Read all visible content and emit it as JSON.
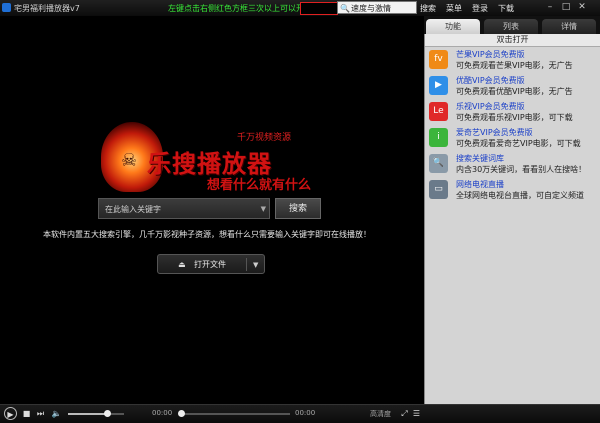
{
  "titlebar": {
    "title": "宅男福利播放器v7",
    "notice": "左键点击右侧红色方框三次以上可以开启隐藏功能",
    "search_value": "速度与激情",
    "menu": [
      "搜索",
      "菜单",
      "登录",
      "下载"
    ]
  },
  "tabs": [
    "功能",
    "列表",
    "详情"
  ],
  "panel": {
    "header": "双击打开",
    "items": [
      {
        "icon": "mango-tv-icon",
        "color": "#f08a16",
        "glyph": "fv",
        "title": "芒果VIP会员免费版",
        "desc": "可免费观看芒果VIP电影，无广告"
      },
      {
        "icon": "youku-icon",
        "color": "#2f8fe8",
        "glyph": "▶",
        "title": "优酷VIP会员免费版",
        "desc": "可免费观看优酷VIP电影，无广告"
      },
      {
        "icon": "letv-icon",
        "color": "#e02828",
        "glyph": "Le",
        "title": "乐视VIP会员免费版",
        "desc": "可免费观看乐视VIP电影，可下载"
      },
      {
        "icon": "iqiyi-icon",
        "color": "#3bb53b",
        "glyph": "i",
        "title": "爱奇艺VIP会员免费版",
        "desc": "可免费观看爱奇艺VIP电影，可下载"
      },
      {
        "icon": "search-keyword-icon",
        "color": "#8a9aa8",
        "glyph": "🔍",
        "title": "搜索关键词库",
        "desc": "内含30万关键词，看看别人在搜啥！"
      },
      {
        "icon": "tv-live-icon",
        "color": "#6a7a8a",
        "glyph": "▭",
        "title": "网络电视直播",
        "desc": "全球网络电视台直播，可自定义频道"
      }
    ]
  },
  "logo": {
    "main": "乐搜播放器",
    "top": "千万视频资源",
    "sub": "想看什么就有什么"
  },
  "main": {
    "input_placeholder": "在此输入关键字",
    "search_label": "搜索",
    "description": "本软件内置五大搜索引擎，几千万影视种子资源，想看什么只需要输入关键字即可在线播放！",
    "open_label": "打开文件"
  },
  "bottom": {
    "time_current": "00:00",
    "time_total": "00:00",
    "quality": "高清度",
    "volume": 0.7,
    "seek": 0.0
  }
}
